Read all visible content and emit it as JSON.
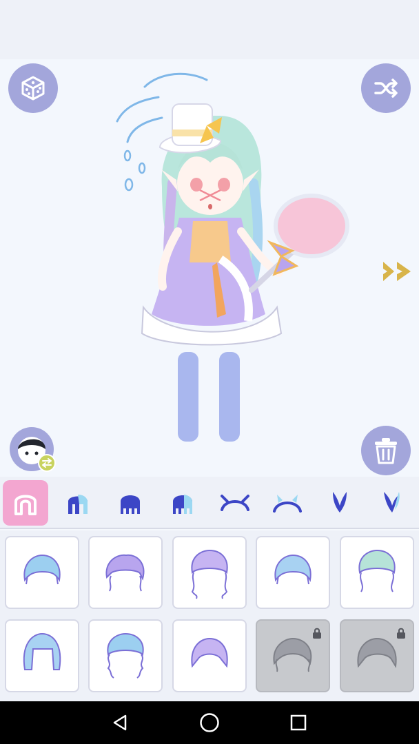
{
  "colors": {
    "button": "#a3a6db",
    "active_tab": "#f3a6d0",
    "accent_arrow": "#d8b44a",
    "tile_locked": "#c7c9cd"
  },
  "stage": {
    "left_button_icon": "dice-icon",
    "right_button_icon": "shuffle-icon",
    "next_icon": "double-chevron-right-icon",
    "face_swap_icon": "face-swap-icon",
    "trash_icon": "trash-icon"
  },
  "categories": [
    {
      "icon": "hair-full-icon",
      "active": true
    },
    {
      "icon": "hair-front-icon",
      "active": false
    },
    {
      "icon": "hair-back-icon",
      "active": false
    },
    {
      "icon": "hair-side-icon",
      "active": false
    },
    {
      "icon": "headband-icon",
      "active": false
    },
    {
      "icon": "horn-headband-icon",
      "active": false
    },
    {
      "icon": "bunny-ears-icon",
      "active": false
    },
    {
      "icon": "bunny-ears-alt-icon",
      "active": false
    }
  ],
  "hair_items": [
    {
      "locked": false
    },
    {
      "locked": false
    },
    {
      "locked": false
    },
    {
      "locked": false
    },
    {
      "locked": false
    },
    {
      "locked": false
    },
    {
      "locked": false
    },
    {
      "locked": false
    },
    {
      "locked": true
    },
    {
      "locked": true
    }
  ],
  "navbar": [
    "back-icon",
    "home-icon",
    "recents-icon"
  ]
}
